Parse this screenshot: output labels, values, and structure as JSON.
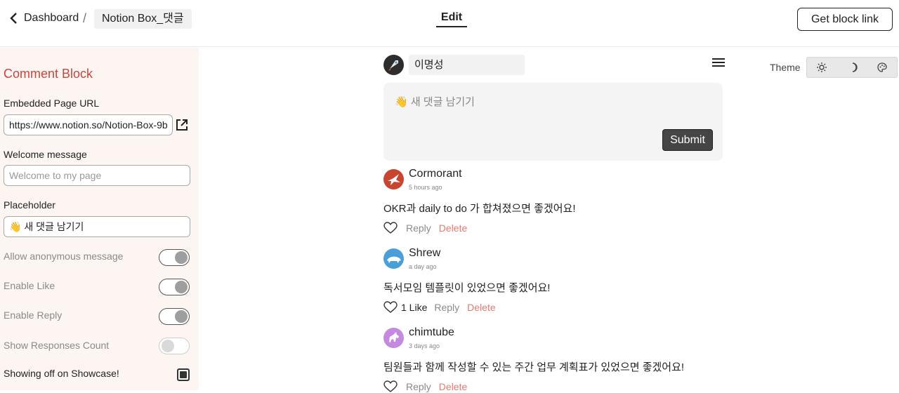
{
  "header": {
    "back_label": "Dashboard",
    "separator": "/",
    "page_name": "Notion Box_댓글",
    "edit_tab": "Edit",
    "get_link": "Get block link"
  },
  "settings": {
    "title": "Comment Block",
    "url_label": "Embedded Page URL",
    "url_value": "https://www.notion.so/Notion-Box-9b",
    "welcome_label": "Welcome message",
    "welcome_placeholder": "Welcome to my page",
    "placeholder_label": "Placeholder",
    "placeholder_value": "👋 새 댓글 남기기",
    "toggles": [
      {
        "label": "Allow anonymous message",
        "on": true
      },
      {
        "label": "Enable Like",
        "on": true
      },
      {
        "label": "Enable Reply",
        "on": true
      },
      {
        "label": "Show Responses Count",
        "on": false
      }
    ],
    "showcase_label": "Showing off on Showcase!",
    "showcase_checked": true
  },
  "composer": {
    "user_name": "이명성",
    "placeholder": "👋 새 댓글 남기기",
    "submit": "Submit"
  },
  "comments": [
    {
      "name": "Cormorant",
      "time": "5 hours ago",
      "text": "OKR과 daily to do 가 합쳐졌으면 좋겠어요!",
      "likes": "",
      "reply": "Reply",
      "delete": "Delete",
      "avatar_color": "#c8452f"
    },
    {
      "name": "Shrew",
      "time": "a day ago",
      "text": "독서모임 템플릿이 있었으면 좋겠어요!",
      "likes": "1 Like",
      "reply": "Reply",
      "delete": "Delete",
      "avatar_color": "#4a9fd8"
    },
    {
      "name": "chimtube",
      "time": "3 days ago",
      "text": "팀원들과 함께 작성할 수 있는 주간 업무 계획표가 있었으면 좋겠어요!",
      "likes": "",
      "reply": "Reply",
      "delete": "Delete",
      "avatar_color": "#c48ae0"
    }
  ],
  "theme": {
    "label": "Theme",
    "options": [
      "sun-icon",
      "moon-icon",
      "palette-icon"
    ]
  }
}
